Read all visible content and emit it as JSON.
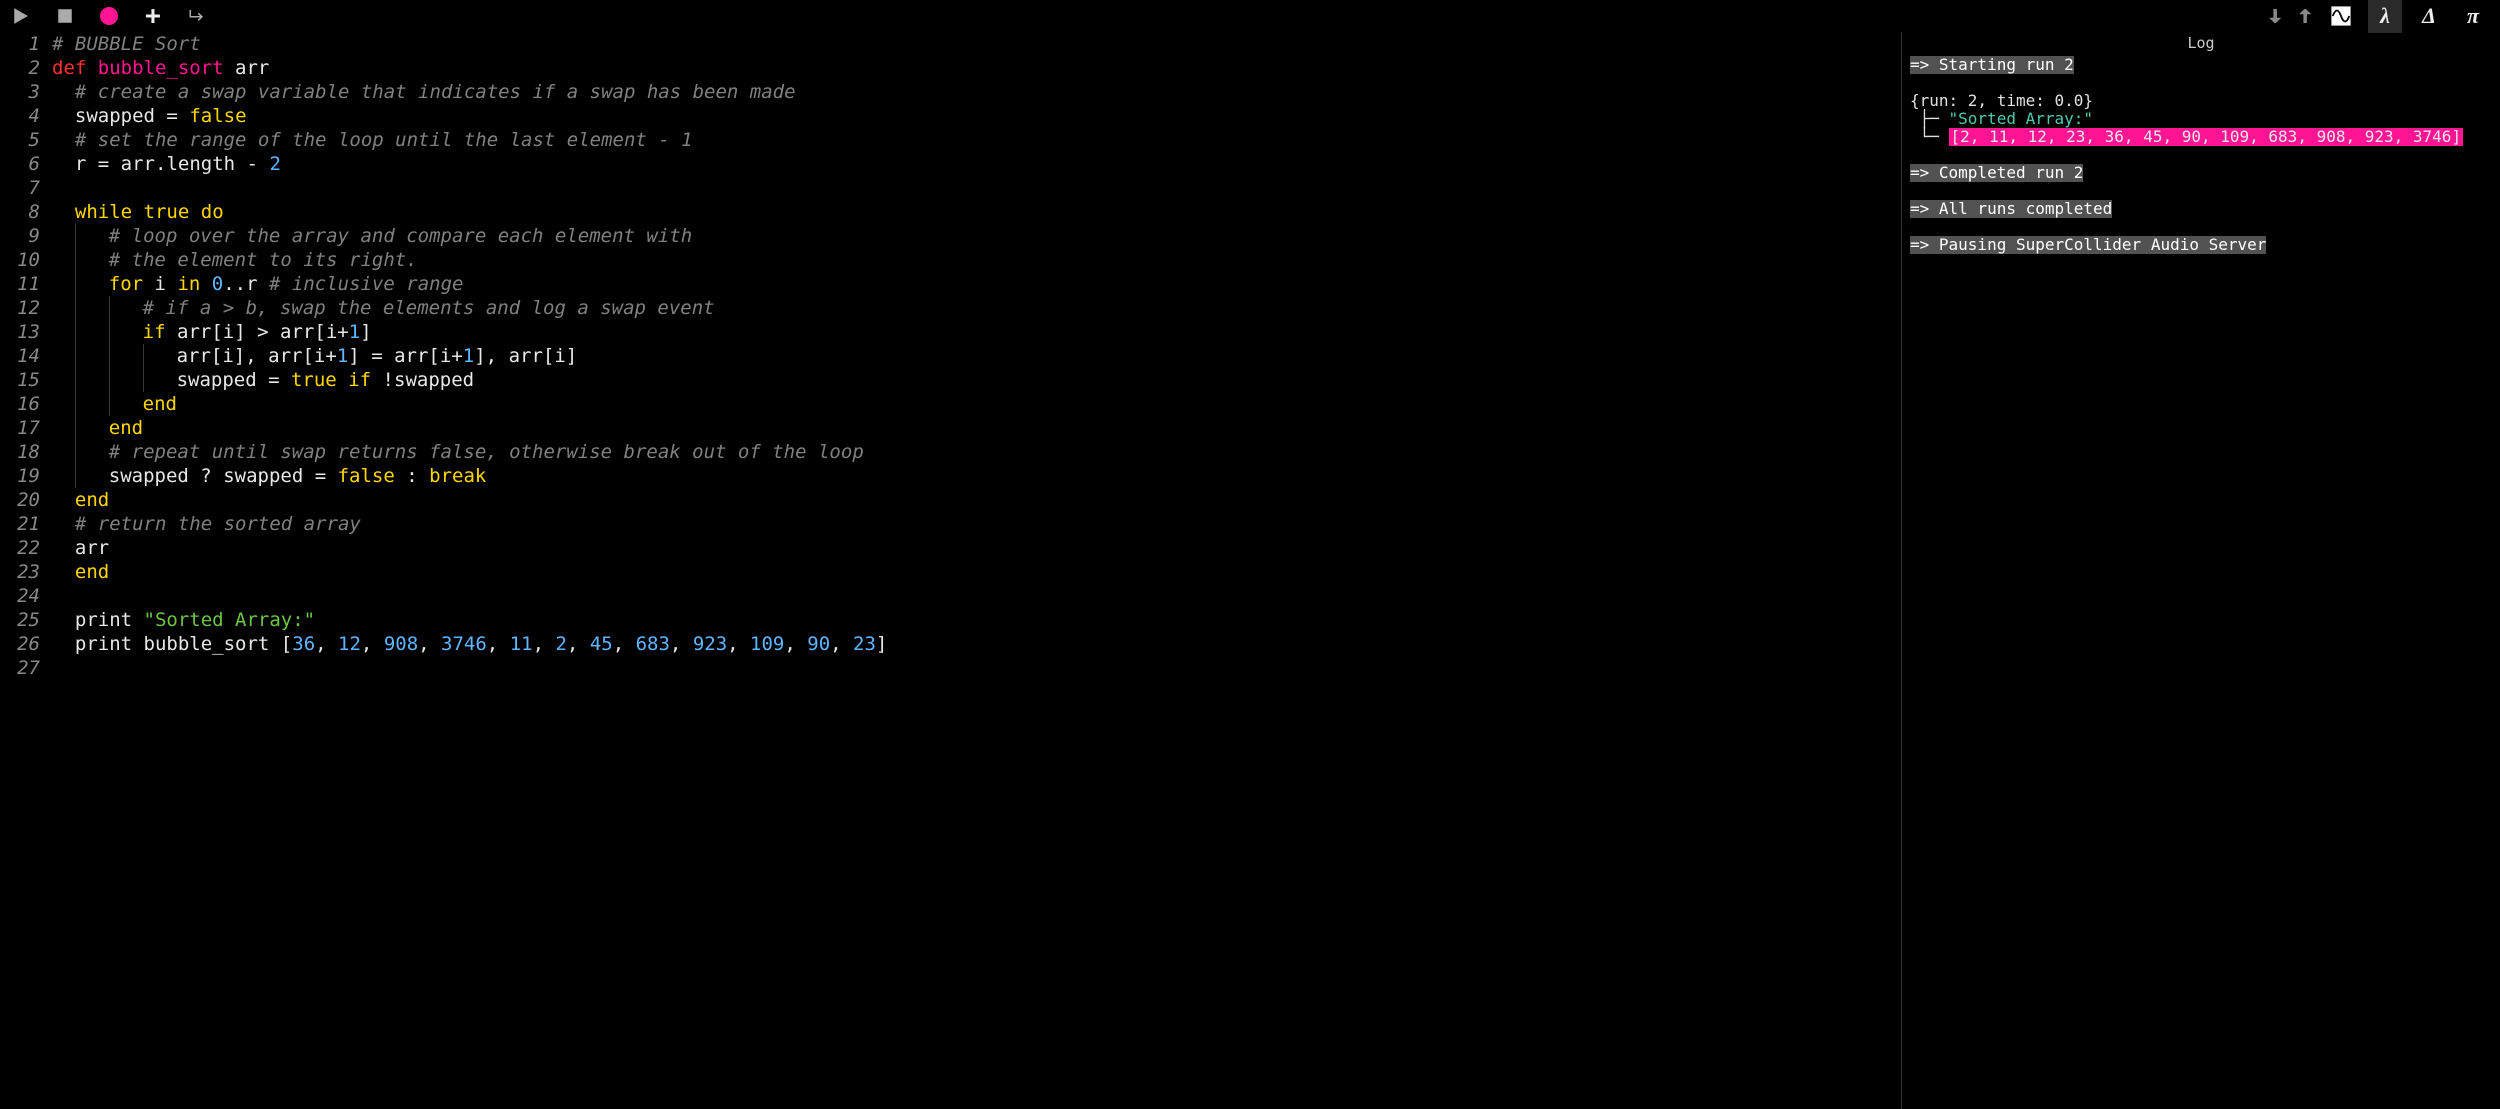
{
  "toolbar": {
    "icons_left": [
      "play",
      "stop",
      "record",
      "plus",
      "indent-return"
    ],
    "icons_right": [
      "size-down",
      "size-up",
      "scope",
      "lambda",
      "delta",
      "pi"
    ]
  },
  "editor": {
    "lines": [
      {
        "n": 1,
        "ind": 0,
        "guides": 0,
        "tokens": [
          {
            "t": "comment",
            "v": "# BUBBLE Sort"
          }
        ]
      },
      {
        "n": 2,
        "ind": 0,
        "guides": 0,
        "tokens": [
          {
            "t": "def",
            "v": "def "
          },
          {
            "t": "fn",
            "v": "bubble_sort"
          },
          {
            "t": "plain",
            "v": " arr"
          }
        ]
      },
      {
        "n": 3,
        "ind": 1,
        "guides": 0,
        "tokens": [
          {
            "t": "comment",
            "v": "# create a swap variable that indicates if a swap has been made"
          }
        ]
      },
      {
        "n": 4,
        "ind": 1,
        "guides": 0,
        "tokens": [
          {
            "t": "plain",
            "v": "swapped "
          },
          {
            "t": "op",
            "v": "="
          },
          {
            "t": "plain",
            "v": " "
          },
          {
            "t": "kw",
            "v": "false"
          }
        ]
      },
      {
        "n": 5,
        "ind": 1,
        "guides": 0,
        "tokens": [
          {
            "t": "comment",
            "v": "# set the range of the loop until the last element - 1"
          }
        ]
      },
      {
        "n": 6,
        "ind": 1,
        "guides": 0,
        "tokens": [
          {
            "t": "plain",
            "v": "r "
          },
          {
            "t": "op",
            "v": "="
          },
          {
            "t": "plain",
            "v": " arr"
          },
          {
            "t": "op",
            "v": "."
          },
          {
            "t": "plain",
            "v": "length "
          },
          {
            "t": "op",
            "v": "-"
          },
          {
            "t": "plain",
            "v": " "
          },
          {
            "t": "num",
            "v": "2"
          }
        ]
      },
      {
        "n": 7,
        "ind": 0,
        "guides": 0,
        "tokens": []
      },
      {
        "n": 8,
        "ind": 1,
        "guides": 0,
        "tokens": [
          {
            "t": "kw",
            "v": "while"
          },
          {
            "t": "plain",
            "v": " "
          },
          {
            "t": "kw",
            "v": "true"
          },
          {
            "t": "plain",
            "v": " "
          },
          {
            "t": "kw",
            "v": "do"
          }
        ]
      },
      {
        "n": 9,
        "ind": 2,
        "guides": 2,
        "tokens": [
          {
            "t": "comment",
            "v": "# loop over the array and compare each element with"
          }
        ]
      },
      {
        "n": 10,
        "ind": 2,
        "guides": 2,
        "tokens": [
          {
            "t": "comment",
            "v": "# the element to its right."
          }
        ]
      },
      {
        "n": 11,
        "ind": 2,
        "guides": 2,
        "tokens": [
          {
            "t": "kw",
            "v": "for"
          },
          {
            "t": "plain",
            "v": " i "
          },
          {
            "t": "kw",
            "v": "in"
          },
          {
            "t": "plain",
            "v": " "
          },
          {
            "t": "num",
            "v": "0"
          },
          {
            "t": "op",
            "v": ".."
          },
          {
            "t": "plain",
            "v": "r "
          },
          {
            "t": "comment",
            "v": "# inclusive range"
          }
        ]
      },
      {
        "n": 12,
        "ind": 3,
        "guides": 3,
        "tokens": [
          {
            "t": "comment",
            "v": "# if a > b, swap the elements and log a swap event"
          }
        ]
      },
      {
        "n": 13,
        "ind": 3,
        "guides": 3,
        "tokens": [
          {
            "t": "kw",
            "v": "if"
          },
          {
            "t": "plain",
            "v": " arr"
          },
          {
            "t": "op",
            "v": "["
          },
          {
            "t": "plain",
            "v": "i"
          },
          {
            "t": "op",
            "v": "]"
          },
          {
            "t": "plain",
            "v": " "
          },
          {
            "t": "op",
            "v": ">"
          },
          {
            "t": "plain",
            "v": " arr"
          },
          {
            "t": "op",
            "v": "["
          },
          {
            "t": "plain",
            "v": "i"
          },
          {
            "t": "op",
            "v": "+"
          },
          {
            "t": "num",
            "v": "1"
          },
          {
            "t": "op",
            "v": "]"
          }
        ]
      },
      {
        "n": 14,
        "ind": 4,
        "guides": 4,
        "tokens": [
          {
            "t": "plain",
            "v": "arr"
          },
          {
            "t": "op",
            "v": "["
          },
          {
            "t": "plain",
            "v": "i"
          },
          {
            "t": "op",
            "v": "]"
          },
          {
            "t": "op",
            "v": ","
          },
          {
            "t": "plain",
            "v": " arr"
          },
          {
            "t": "op",
            "v": "["
          },
          {
            "t": "plain",
            "v": "i"
          },
          {
            "t": "op",
            "v": "+"
          },
          {
            "t": "num",
            "v": "1"
          },
          {
            "t": "op",
            "v": "]"
          },
          {
            "t": "plain",
            "v": " "
          },
          {
            "t": "op",
            "v": "="
          },
          {
            "t": "plain",
            "v": " arr"
          },
          {
            "t": "op",
            "v": "["
          },
          {
            "t": "plain",
            "v": "i"
          },
          {
            "t": "op",
            "v": "+"
          },
          {
            "t": "num",
            "v": "1"
          },
          {
            "t": "op",
            "v": "]"
          },
          {
            "t": "op",
            "v": ","
          },
          {
            "t": "plain",
            "v": " arr"
          },
          {
            "t": "op",
            "v": "["
          },
          {
            "t": "plain",
            "v": "i"
          },
          {
            "t": "op",
            "v": "]"
          }
        ]
      },
      {
        "n": 15,
        "ind": 4,
        "guides": 4,
        "tokens": [
          {
            "t": "plain",
            "v": "swapped "
          },
          {
            "t": "op",
            "v": "="
          },
          {
            "t": "plain",
            "v": " "
          },
          {
            "t": "kw",
            "v": "true"
          },
          {
            "t": "plain",
            "v": " "
          },
          {
            "t": "kw",
            "v": "if"
          },
          {
            "t": "plain",
            "v": " "
          },
          {
            "t": "op",
            "v": "!"
          },
          {
            "t": "plain",
            "v": "swapped"
          }
        ]
      },
      {
        "n": 16,
        "ind": 3,
        "guides": 3,
        "tokens": [
          {
            "t": "kw",
            "v": "end"
          }
        ]
      },
      {
        "n": 17,
        "ind": 2,
        "guides": 2,
        "tokens": [
          {
            "t": "kw",
            "v": "end"
          }
        ]
      },
      {
        "n": 18,
        "ind": 2,
        "guides": 2,
        "tokens": [
          {
            "t": "comment",
            "v": "# repeat until swap returns false, otherwise break out of the loop"
          }
        ]
      },
      {
        "n": 19,
        "ind": 2,
        "guides": 2,
        "tokens": [
          {
            "t": "plain",
            "v": "swapped "
          },
          {
            "t": "op",
            "v": "?"
          },
          {
            "t": "plain",
            "v": " swapped "
          },
          {
            "t": "op",
            "v": "="
          },
          {
            "t": "plain",
            "v": " "
          },
          {
            "t": "kw",
            "v": "false"
          },
          {
            "t": "plain",
            "v": " "
          },
          {
            "t": "op",
            "v": ":"
          },
          {
            "t": "plain",
            "v": " "
          },
          {
            "t": "kw",
            "v": "break"
          }
        ]
      },
      {
        "n": 20,
        "ind": 1,
        "guides": 1,
        "tokens": [
          {
            "t": "kw",
            "v": "end"
          }
        ]
      },
      {
        "n": 21,
        "ind": 1,
        "guides": 1,
        "tokens": [
          {
            "t": "comment",
            "v": "# return the sorted array"
          }
        ]
      },
      {
        "n": 22,
        "ind": 1,
        "guides": 1,
        "tokens": [
          {
            "t": "plain",
            "v": "arr"
          }
        ]
      },
      {
        "n": 23,
        "ind": 1,
        "guides": 0,
        "tokens": [
          {
            "t": "kw",
            "v": "end"
          }
        ]
      },
      {
        "n": 24,
        "ind": 0,
        "guides": 0,
        "tokens": []
      },
      {
        "n": 25,
        "ind": 1,
        "guides": 0,
        "tokens": [
          {
            "t": "plain",
            "v": "print "
          },
          {
            "t": "str",
            "v": "\"Sorted Array:\""
          }
        ]
      },
      {
        "n": 26,
        "ind": 1,
        "guides": 0,
        "tokens": [
          {
            "t": "plain",
            "v": "print bubble_sort "
          },
          {
            "t": "op",
            "v": "["
          },
          {
            "t": "num",
            "v": "36"
          },
          {
            "t": "op",
            "v": ", "
          },
          {
            "t": "num",
            "v": "12"
          },
          {
            "t": "op",
            "v": ", "
          },
          {
            "t": "num",
            "v": "908"
          },
          {
            "t": "op",
            "v": ", "
          },
          {
            "t": "num",
            "v": "3746"
          },
          {
            "t": "op",
            "v": ", "
          },
          {
            "t": "num",
            "v": "11"
          },
          {
            "t": "op",
            "v": ", "
          },
          {
            "t": "num",
            "v": "2"
          },
          {
            "t": "op",
            "v": ", "
          },
          {
            "t": "num",
            "v": "45"
          },
          {
            "t": "op",
            "v": ", "
          },
          {
            "t": "num",
            "v": "683"
          },
          {
            "t": "op",
            "v": ", "
          },
          {
            "t": "num",
            "v": "923"
          },
          {
            "t": "op",
            "v": ", "
          },
          {
            "t": "num",
            "v": "109"
          },
          {
            "t": "op",
            "v": ", "
          },
          {
            "t": "num",
            "v": "90"
          },
          {
            "t": "op",
            "v": ", "
          },
          {
            "t": "num",
            "v": "23"
          },
          {
            "t": "op",
            "v": "]"
          }
        ]
      },
      {
        "n": 27,
        "ind": 0,
        "guides": 0,
        "tokens": []
      }
    ]
  },
  "log": {
    "title": "Log",
    "start": "=> Starting run 2",
    "cue": "{run: 2, time: 0.0}",
    "tree1_prefix": " ├─ ",
    "tree1_val": "\"Sorted Array:\"",
    "tree2_prefix": " └─ ",
    "tree2_val": "[2, 11, 12, 23, 36, 45, 90, 109, 683, 908, 923, 3746]",
    "completed": "=> Completed run 2",
    "allruns": "=> All runs completed",
    "pausing": "=> Pausing SuperCollider Audio Server"
  }
}
